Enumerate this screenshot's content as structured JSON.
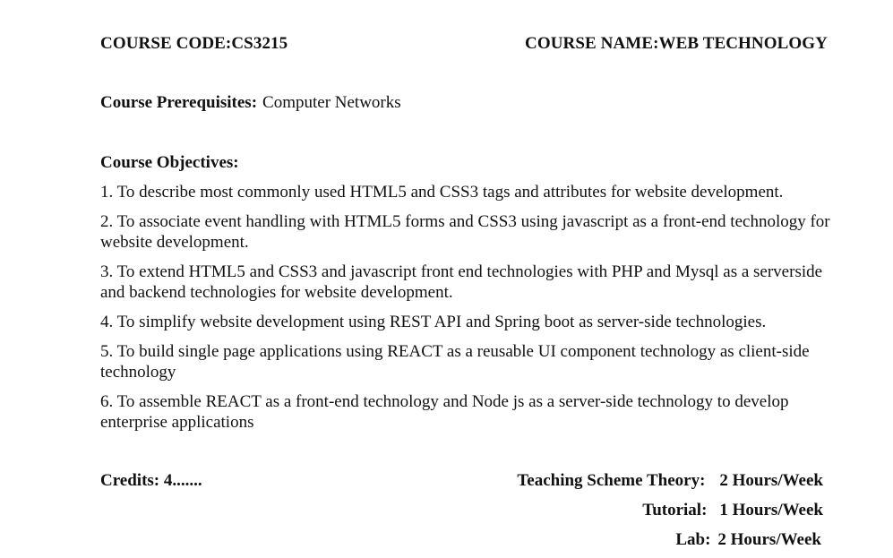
{
  "header": {
    "course_code": "COURSE CODE:CS3215",
    "course_name": "COURSE NAME:WEB TECHNOLOGY"
  },
  "prerequisites": {
    "label": "Course Prerequisites:",
    "value": "Computer Networks"
  },
  "objectives": {
    "title": "Course Objectives:",
    "items": [
      "1. To describe most commonly used HTML5 and CSS3 tags and attributes for website development.",
      "2.  To associate event handling with HTML5 forms and CSS3 using javascript as a front-end technology for website development.",
      "3.  To extend HTML5 and CSS3 and javascript front end technologies with PHP and Mysql as a serverside and backend technologies for website development.",
      "4.  To simplify website development using REST API and Spring boot as server-side technologies.",
      "5.  To build single page applications using REACT as a reusable UI component technology as client-side technology",
      "6. To assemble REACT as a front-end technology and Node js as a server-side technology to develop enterprise applications"
    ]
  },
  "credits": "Credits: 4.......",
  "teaching_scheme": {
    "theory_label": "Teaching Scheme Theory:",
    "theory_value": "2 Hours/Week",
    "tutorial_label": "Tutorial:",
    "tutorial_value": "1 Hours/Week",
    "lab_label": "Lab:",
    "lab_value": "2 Hours/Week"
  }
}
